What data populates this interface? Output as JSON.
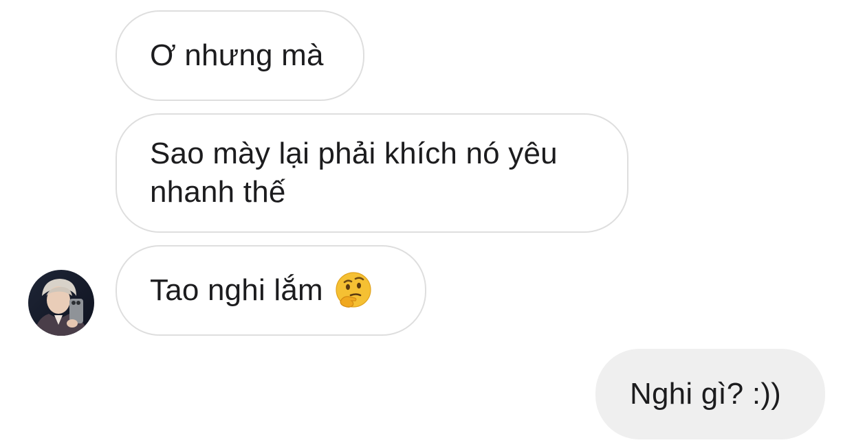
{
  "conversation": {
    "messages": [
      {
        "direction": "incoming",
        "text": "Ơ nhưng mà"
      },
      {
        "direction": "incoming",
        "text": "Sao mày lại phải khích nó yêu nhanh thế"
      },
      {
        "direction": "incoming",
        "text": "Tao nghi lắm",
        "emoji": "thinking-face-icon"
      },
      {
        "direction": "outgoing",
        "text": "Nghi gì? :))"
      }
    ],
    "contact_avatar": "avatar",
    "colors": {
      "incoming_bubble_border": "#dedede",
      "outgoing_bubble_bg": "#efefef",
      "text": "#1c1c1e"
    }
  }
}
